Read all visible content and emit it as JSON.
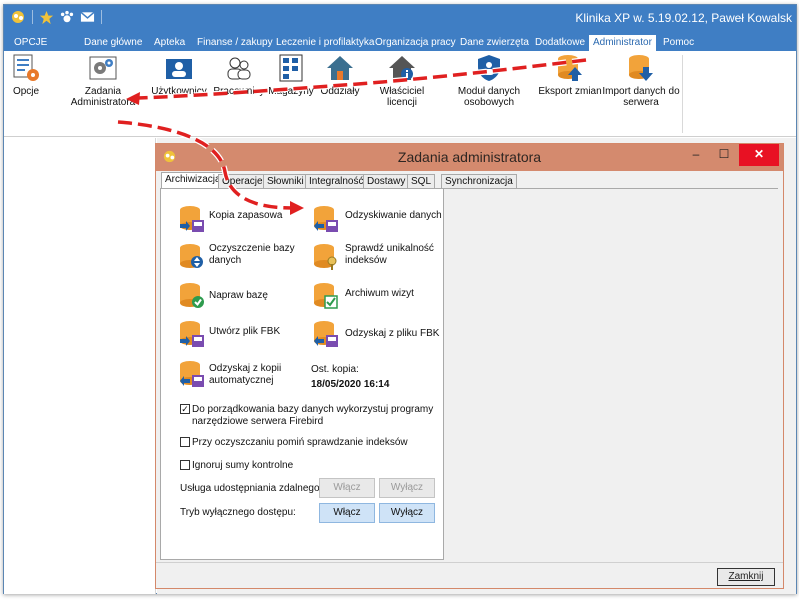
{
  "app": {
    "title": "Klinika XP w. 5.19.02.12, Paweł Kowalsk"
  },
  "menu": [
    {
      "label": "OPCJE"
    },
    {
      "label": "Dane główne"
    },
    {
      "label": "Apteka"
    },
    {
      "label": "Finanse / zakupy"
    },
    {
      "label": "Leczenie i profilaktyka"
    },
    {
      "label": "Organizacja pracy"
    },
    {
      "label": "Dane zwierzęta"
    },
    {
      "label": "Dodatkowe"
    },
    {
      "label": "Administrator"
    },
    {
      "label": "Pomoc"
    }
  ],
  "ribbon": {
    "opcje": "Opcje",
    "zadania_line1": "Zadania",
    "zadania_line2": "Administratora",
    "uzytkownicy": "Użytkownicy",
    "pracownicy": "Pracownicy",
    "magazyny": "Magazyny",
    "oddzialy": "Oddziały",
    "wlasciciel": "Właściciel licencji",
    "modul_line1": "Moduł danych",
    "modul_line2": "osobowych",
    "eksport": "Eksport zmian",
    "import_line1": "Import danych do",
    "import_line2": "serwera"
  },
  "dialog": {
    "title": "Zadania administratora",
    "close_glyph": "✕",
    "max_glyph": "☐",
    "min_glyph": "–",
    "tabs": [
      "Archiwizacja",
      "Operacje",
      "Słowniki",
      "Integralność",
      "Dostawy",
      "SQL",
      "Synchronizacja"
    ],
    "actions": {
      "kopia": "Kopia zapasowa",
      "odzyskiwanie": "Odzyskiwanie danych",
      "oczyszczenie_line1": "Oczyszczenie bazy",
      "oczyszczenie_line2": "danych",
      "sprawdz_line1": "Sprawdź unikalność",
      "sprawdz_line2": "indeksów",
      "napraw": "Napraw bazę",
      "archiwum": "Archiwum wizyt",
      "utworz_fbk": "Utwórz plik FBK",
      "odzyskaj_fbk": "Odzyskaj z pliku FBK",
      "odzyskaj_auto_line1": "Odzyskaj z kopii",
      "odzyskaj_auto_line2": "automatycznej"
    },
    "last_copy_label": "Ost. kopia:",
    "last_copy_value": "18/05/2020 16:14",
    "checks": {
      "firebird_line1": "Do porządkowania bazy danych wykorzystuj programy",
      "firebird_line2": "narzędziowe serwera Firebird",
      "firebird_checked": "✓",
      "pomin": "Przy oczyszczaniu pomiń sprawdzanie indeksów",
      "ignoruj": "Ignoruj sumy kontrolne"
    },
    "remote_label": "Usługa udostępniania zdalnego:",
    "exclusive_label": "Tryb wyłącznego dostępu:",
    "wlacz": "Włącz",
    "wylacz": "Wyłącz",
    "zamknij": "Zamknij"
  },
  "colors": {
    "titlebar": "#3f7ec4",
    "dialog_title": "#d48a6e",
    "arrow": "#e02020",
    "active_button": "#cfe3f7"
  }
}
